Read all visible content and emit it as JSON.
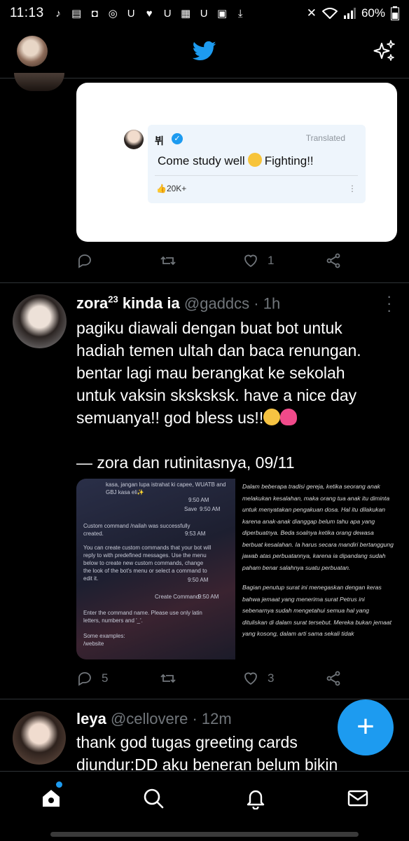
{
  "statusbar": {
    "time": "11:13",
    "notif_icons": [
      "tiktok-icon",
      "stack-icon",
      "message-icon",
      "u-icon",
      "heart-icon",
      "u-icon",
      "keyboard-icon",
      "u-icon",
      "image-icon",
      "download-icon"
    ],
    "battery": "60%"
  },
  "header": {
    "brand_color": "#1d9bf0"
  },
  "tweet1": {
    "card": {
      "author": "뷔",
      "translated_label": "Translated",
      "text_before": "Come study well",
      "text_after": "Fighting!!",
      "likes": "20K+"
    },
    "actions": {
      "reply": "",
      "retweet": "",
      "like": "1"
    }
  },
  "tweet2": {
    "name": "zora",
    "name_sup": "23",
    "name_suffix": " kinda ia",
    "handle": "@gaddcs · 1h",
    "lines": [
      "pagiku diawali dengan buat bot untuk",
      "hadiah temen ultah dan baca renungan.",
      "bentar lagi mau berangkat ke sekolah",
      "untuk vaksin sksksksk. have a nice day",
      "semuanya!! god bless us!!"
    ],
    "signature": "— zora dan rutinitasnya, 09/11",
    "media_left": {
      "top": "kasa, jangan lupa istrahat ki capee, WUATB and GBJ kasa eli✨",
      "time1": "9:50 AM",
      "save": "Save",
      "time2": "9:50 AM",
      "msg1": "Custom command /nailah was successfully created.",
      "time3": "9:53 AM",
      "msg2": "You can create custom commands that your bot will reply to with predefined messages. Use the menu below to create new custom commands, change the look of the bot's menu or select a command to edit it.",
      "time4": "9:50 AM",
      "create": "Create Command",
      "time5": "9:50 AM",
      "msg3": "Enter the command name. Please use only latin letters, numbers and '_'.",
      "msg4": "Some examples:",
      "msg5": "/website"
    },
    "media_right": {
      "p1": "Dalam beberapa tradisi gereja, ketika seorang anak melakukan kesalahan, maka orang tua anak itu diminta untuk menyatakan pengakuan dosa. Hal itu dilakukan karena anak-anak dianggap belum tahu apa yang diperbuatnya. Beda soalnya ketika orang dewasa berbuat kesalahan. Ia harus secara mandiri bertanggung jawab atas perbuatannya, karena ia dipandang sudah paham benar salahnya suatu perbuatan.",
      "p2": "Bagian penutup surat ini menegaskan dengan keras bahwa jemaat yang menerima surat Petrus ini sebenarnya sudah mengetahui semua hal yang dituliskan di dalam surat tersebut. Mereka bukan jemaat yang kosong, dalam arti sama sekali tidak"
    },
    "actions": {
      "reply": "5",
      "retweet": "",
      "like": "3"
    }
  },
  "tweet3": {
    "name": "leya",
    "handle": "@cellovere · 12m",
    "lines": [
      "thank god tugas greeting cards",
      "diundur:DD aku beneran belum bikin"
    ]
  },
  "fab": {
    "label": "+"
  },
  "nav": [
    "home-icon",
    "search-icon",
    "notifications-icon",
    "messages-icon"
  ]
}
